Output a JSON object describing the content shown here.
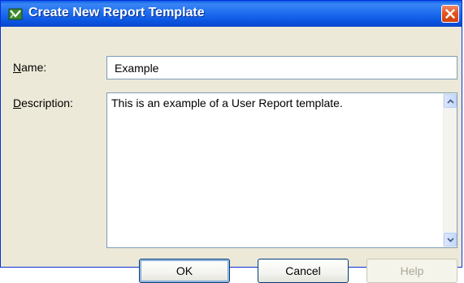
{
  "window": {
    "title": "Create New Report Template",
    "close_label": "Close"
  },
  "form": {
    "name_label": "Name:",
    "name_label_accel": "N",
    "name_label_rest": "ame:",
    "name_value": "Example",
    "description_label_accel": "D",
    "description_label_rest": "escription:",
    "description_value": "This is an example of a User Report template."
  },
  "buttons": {
    "ok": "OK",
    "cancel": "Cancel",
    "help": "Help"
  },
  "icons": {
    "app": "report-template-icon",
    "close": "close-icon",
    "scroll_up": "chevron-up-icon",
    "scroll_down": "chevron-down-icon"
  },
  "colors": {
    "titlebar": "#0a54e0",
    "dialog_bg": "#ece9d8",
    "close_button": "#e4541e"
  }
}
